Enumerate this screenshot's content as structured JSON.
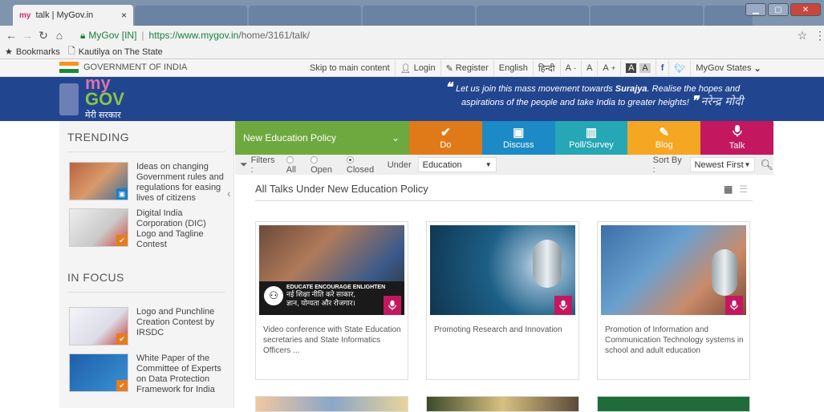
{
  "browser": {
    "tab_title": "talk | MyGov.in",
    "tab_close": "×",
    "site_label": "MyGov [IN]",
    "url_prefix": "https://www.mygov.in",
    "url_path": "/home/3161/talk/",
    "bookmarks_label": "Bookmarks",
    "bookmark_item": "Kautilya on The State"
  },
  "govbar": {
    "gov_label": "GOVERNMENT OF INDIA",
    "skip": "Skip to main content",
    "login": "Login",
    "register": "Register",
    "english": "English",
    "hindi": "हिन्दी",
    "a_minus": "A",
    "a_normal": "A",
    "a_plus": "A",
    "a_dark": "A",
    "a_light": "A",
    "states": "MyGov States"
  },
  "header": {
    "logo_my": "my",
    "logo_gov": "GOV",
    "logo_hindi": "मेरी सरकार",
    "quote_line1_pre": "Let us join this mass movement towards ",
    "quote_bold": "Surajya",
    "quote_line1_post": ". Realise the hopes and",
    "quote_line2": "aspirations of the people and take India to greater heights!",
    "signature": "नरेन्द्र मोदी"
  },
  "sidebar": {
    "trending_title": "TRENDING",
    "trending": [
      {
        "text": "Ideas on changing Government rules and regulations for easing lives of citizens",
        "thumb_color": "#b8633f",
        "badge_color": "#1d7fc3"
      },
      {
        "text": "Digital India Corporation (DIC) Logo and Tagline Contest",
        "thumb_color": "#d9d9d9",
        "badge_color": "#e77b1e"
      }
    ],
    "infocus_title": "IN FOCUS",
    "infocus": [
      {
        "text": "Logo and Punchline Creation Contest by IRSDC",
        "thumb_color": "#e9e9ef",
        "badge_color": "#e77b1e"
      },
      {
        "text": "White Paper of the Committee of Experts on Data Protection Framework for India",
        "thumb_color": "#2d7fc9",
        "badge_color": "#e77b1e"
      }
    ]
  },
  "nav": {
    "policy": "New Education Policy",
    "tabs": [
      {
        "label": "Do",
        "glyph": "✔",
        "color": "#e07a18"
      },
      {
        "label": "Discuss",
        "glyph": "▣",
        "color": "#1b8ac7"
      },
      {
        "label": "Poll/Survey",
        "glyph": "▥",
        "color": "#26a7b5"
      },
      {
        "label": "Blog",
        "glyph": "✎",
        "color": "#f5a623"
      },
      {
        "label": "Talk",
        "glyph": "🎙",
        "color": "#c3185f"
      }
    ]
  },
  "filter": {
    "label": "Filters :",
    "opt_all": "All",
    "opt_open": "Open",
    "opt_closed": "Closed",
    "under": "Under",
    "category": "Education",
    "sort_label": "Sort By :",
    "sort_value": "Newest First"
  },
  "main": {
    "title": "All Talks Under New Education Policy",
    "cards": [
      {
        "caption": "Video conference with State Education secretaries and State Informatics Officers ...",
        "banner_en": "EDUCATE ENCOURAGE ENLIGHTEN",
        "banner_hi1": "नई शिक्षा नीति करे साकार,",
        "banner_hi2": "ज्ञान, योग्यता और रोजगार।"
      },
      {
        "caption": "Promoting Research and Innovation"
      },
      {
        "caption": "Promotion of Information and Communication Technology systems in school and adult education"
      }
    ]
  },
  "colors": {
    "header_blue": "#22458f",
    "talk_magenta": "#c3185f",
    "policy_green": "#6ea93f"
  }
}
